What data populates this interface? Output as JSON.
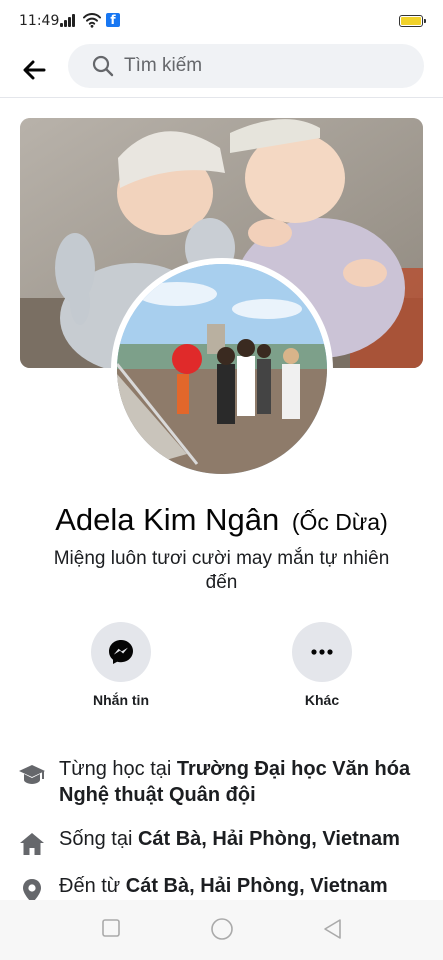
{
  "status_bar": {
    "time": "11:49",
    "battery_color": "#f1d22a"
  },
  "header": {
    "back_icon": "arrow-left-icon",
    "search_placeholder": "Tìm kiếm"
  },
  "profile": {
    "name": "Adela Kim Ngân",
    "alternate_name": "(Ốc Dừa)",
    "bio": "Miệng luôn tươi cười may mắn tự nhiên đến"
  },
  "actions": [
    {
      "label": "Nhắn tin",
      "icon": "messenger-icon"
    },
    {
      "label": "Khác",
      "icon": "more-icon"
    }
  ],
  "intro": [
    {
      "icon": "education-icon",
      "prefix": "Từng học tại ",
      "value": "Trường Đại học Văn hóa Nghệ thuật Quân đội"
    },
    {
      "icon": "home-icon",
      "prefix": "Sống tại ",
      "value": "Cát Bà, Hải Phòng, Vietnam"
    },
    {
      "icon": "location-icon",
      "prefix": "Đến từ ",
      "value": "Cát Bà, Hải Phòng, Vietnam"
    }
  ],
  "colors": {
    "brand": "#1877f2",
    "chip_bg": "#e4e6eb",
    "search_bg": "#f0f2f5"
  }
}
